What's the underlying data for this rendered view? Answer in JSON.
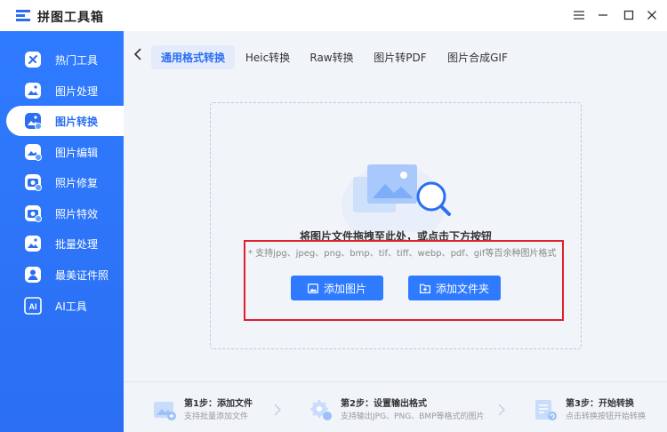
{
  "app": {
    "title": "拼图工具箱"
  },
  "window_controls": [
    "menu-icon",
    "minimize-icon",
    "maximize-icon",
    "close-icon"
  ],
  "sidebar": {
    "items": [
      {
        "label": "热门工具",
        "icon": "hot-tools-icon"
      },
      {
        "label": "图片处理",
        "icon": "image-processing-icon"
      },
      {
        "label": "图片转换",
        "icon": "image-convert-icon",
        "active": true
      },
      {
        "label": "图片编辑",
        "icon": "image-edit-icon"
      },
      {
        "label": "照片修复",
        "icon": "photo-repair-icon"
      },
      {
        "label": "照片特效",
        "icon": "photo-effects-icon"
      },
      {
        "label": "批量处理",
        "icon": "batch-process-icon"
      },
      {
        "label": "最美证件照",
        "icon": "id-photo-icon"
      },
      {
        "label": "AI工具",
        "icon": "ai-tools-icon"
      }
    ]
  },
  "tabs": [
    {
      "label": "通用格式转换",
      "active": true
    },
    {
      "label": "Heic转换"
    },
    {
      "label": "Raw转换"
    },
    {
      "label": "图片转PDF"
    },
    {
      "label": "图片合成GIF"
    }
  ],
  "dropzone": {
    "title": "将图片文件拖拽至此处，或点击下方按钮",
    "subtitle": "* 支持jpg、jpeg、png、bmp、tif、tiff、webp、pdf、gif等百余种图片格式",
    "add_image_label": "添加图片",
    "add_folder_label": "添加文件夹"
  },
  "steps": [
    {
      "title": "第1步：添加文件",
      "desc": "支持批量添加文件"
    },
    {
      "title": "第2步：设置输出格式",
      "desc": "支持输出JPG、PNG、BMP等格式的图片"
    },
    {
      "title": "第3步：开始转换",
      "desc": "点击转换按钮开始转换"
    }
  ],
  "colors": {
    "accent": "#2b6ef2",
    "highlight_box": "#e0202b",
    "main_bg": "#f1f4f9"
  }
}
